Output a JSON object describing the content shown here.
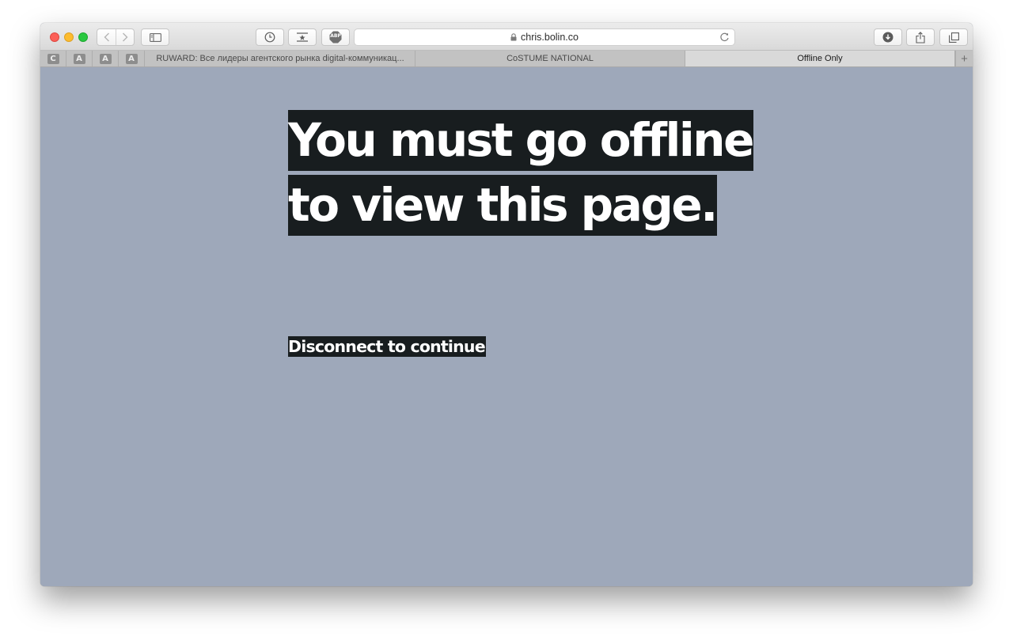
{
  "browser": {
    "url": "chris.bolin.co",
    "pinned_tabs": [
      "C",
      "A",
      "A",
      "A"
    ],
    "tabs": [
      {
        "label": "RUWARD: Все лидеры агентского рынка digital-коммуникац..."
      },
      {
        "label": "CoSTUME NATIONAL"
      },
      {
        "label": "Offline Only"
      }
    ],
    "new_tab_label": "+",
    "icons": {
      "back": "chevron-left-icon",
      "forward": "chevron-right-icon",
      "sidebar": "sidebar-icon",
      "history": "clock-icon",
      "bookmark": "star-tray-icon",
      "adblock": "abp-icon",
      "lock": "lock-icon",
      "reload": "reload-icon",
      "downloads": "download-icon",
      "share": "share-icon",
      "tabs_overview": "tabs-icon"
    },
    "adblock_label": "ABP"
  },
  "page": {
    "headline": "You must go offline to view this page.",
    "subline": "Disconnect to continue",
    "colors": {
      "background": "#9ea8ba",
      "highlight": "#181d1f",
      "text": "#ffffff"
    }
  }
}
